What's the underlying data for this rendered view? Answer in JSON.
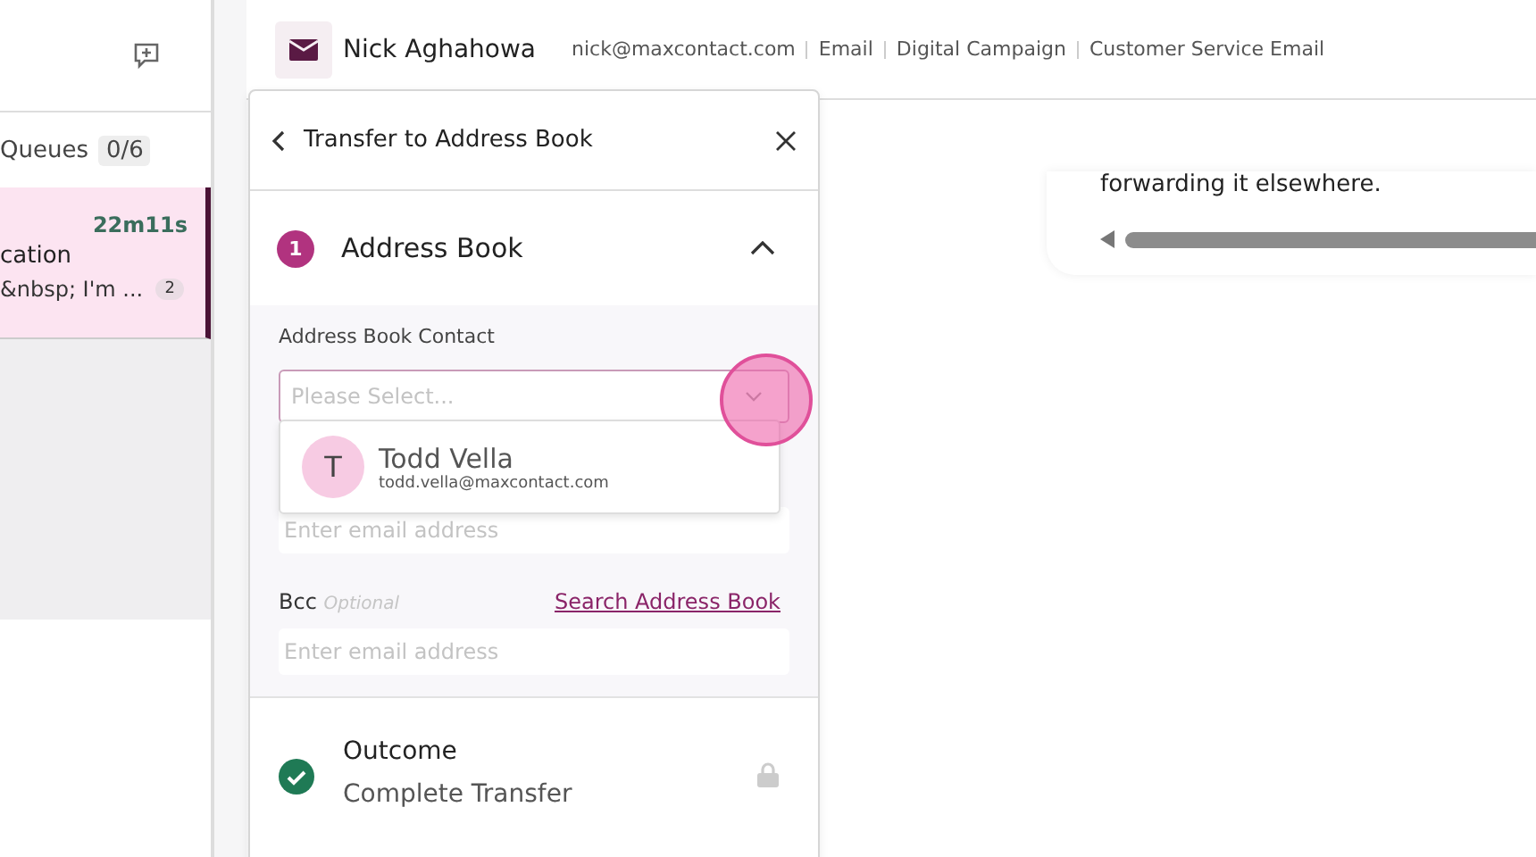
{
  "sidebar": {
    "queues_label": "Queues",
    "queues_count": "0/6",
    "conversation": {
      "time": "22m11s",
      "title": "cation",
      "preview": "&nbsp; I'm ...",
      "unread": "2",
      "selected": true
    }
  },
  "header": {
    "name": "Nick Aghahowa",
    "details": [
      "nick@maxcontact.com",
      "Email",
      "Digital Campaign",
      "Customer Service Email"
    ]
  },
  "message": {
    "text": "forwarding it elsewhere."
  },
  "panel": {
    "title": "Transfer to Address Book",
    "step": {
      "number": "1",
      "title": "Address Book",
      "expanded": true
    },
    "contact_label": "Address Book Contact",
    "select_placeholder": "Please Select...",
    "option": {
      "initial": "T",
      "name": "Todd Vella",
      "email": "todd.vella@maxcontact.com"
    },
    "cc_placeholder": "Enter email address",
    "bcc": {
      "label": "Bcc",
      "hint": "Optional",
      "link": "Search Address Book",
      "placeholder": "Enter email address"
    },
    "outcome": {
      "title": "Outcome",
      "value": "Complete Transfer",
      "completed": true,
      "locked": true
    }
  }
}
